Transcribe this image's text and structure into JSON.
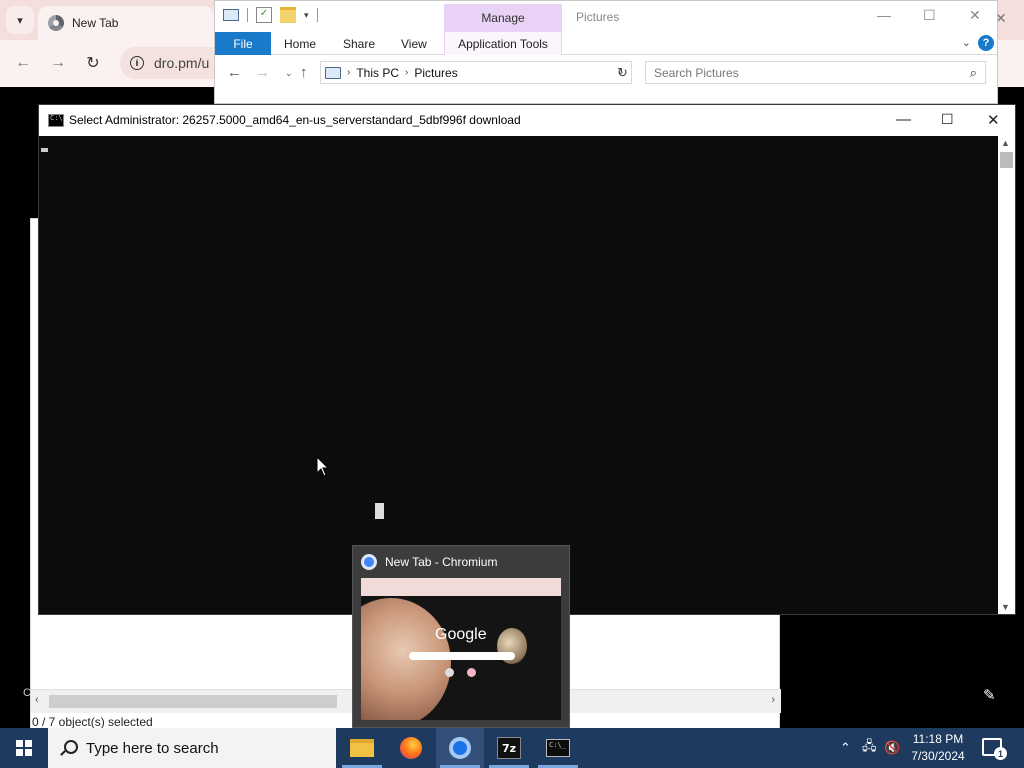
{
  "chromium": {
    "tab_dropdown_icon": "chevron-down-icon",
    "tab_title": "New Tab",
    "url": "dro.pm/u",
    "close_glyph": "✕"
  },
  "explorer": {
    "manage_label": "Manage",
    "title": "Pictures",
    "ribbon_tabs": {
      "file": "File",
      "home": "Home",
      "share": "Share",
      "view": "View",
      "app_tools": "Application Tools"
    },
    "breadcrumb": [
      "This PC",
      "Pictures"
    ],
    "search_placeholder": "Search Pictures",
    "status": "0 / 7 object(s) selected",
    "help": "?"
  },
  "cmd": {
    "title": "Select Administrator:  26257.5000_amd64_en-us_serverstandard_5dbf996f download"
  },
  "preview": {
    "title": "New Tab - Chromium",
    "thumbnail_text": "Google"
  },
  "taskbar": {
    "search_text": "Type here to search",
    "apps": [
      "File Explorer",
      "Firefox",
      "Chromium",
      "7-Zip",
      "Command Prompt"
    ],
    "sevenzip_label": "7z",
    "time": "11:18 PM",
    "date": "7/30/2024",
    "notification_count": "1",
    "accent_color": "#1e3a5f"
  },
  "misc": {
    "left_edge_char": "C"
  }
}
